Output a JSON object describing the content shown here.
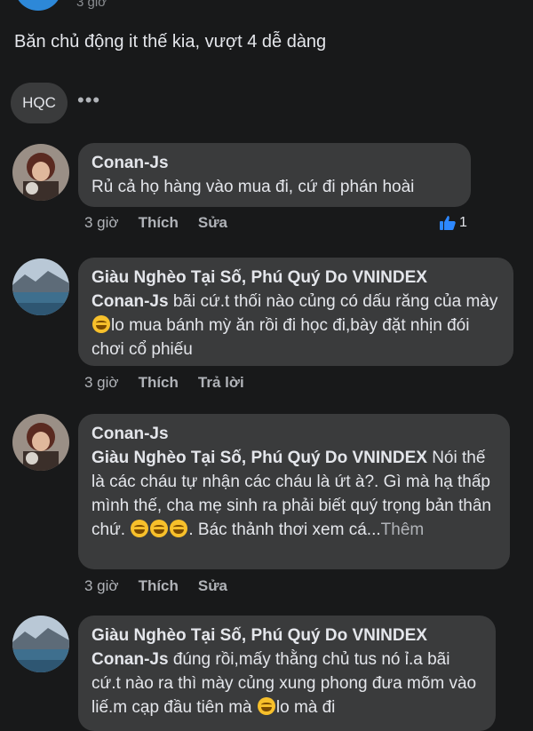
{
  "top": {
    "time": "3 giờ"
  },
  "post": {
    "text": "Băn chủ động it thế kia, vượt 4 dễ dàng"
  },
  "reply_bar": {
    "label": "HQC",
    "more": "•••"
  },
  "comments": [
    {
      "author": "Conan-Js",
      "text": "Rủ cả họ hàng vào mua đi, cứ đi phán hoài",
      "time": "3 giờ",
      "like": "Thích",
      "action2": "Sửa",
      "reactions": "1"
    },
    {
      "author": "Giàu Nghèo Tại Số, Phú Quý Do VNINDEX",
      "tag": "Conan-Js",
      "text_a": "  bãi cứ.t thối nào củng có dấu răng của mày ",
      "text_b": "lo mua bánh mỳ ăn rồi đi học đi,bày đặt nhịn đói chơi cổ phiếu",
      "time": "3 giờ",
      "like": "Thích",
      "action2": "Trả lời"
    },
    {
      "author": "Conan-Js",
      "tag": "Giàu Nghèo Tại Số, Phú Quý Do VNINDEX",
      "text_a": "  Nói thế là các cháu tự nhận các cháu là ứt à?. Gì mà hạ thấp mình thế, cha mẹ sinh ra phải biết quý trọng bản thân chứ. ",
      "text_b": ". Bác thảnh thơi xem cá...",
      "more": "Thêm",
      "time": "3 giờ",
      "like": "Thích",
      "action2": "Sửa"
    },
    {
      "author": "Giàu Nghèo Tại Số, Phú Quý Do VNINDEX",
      "tag": "Conan-Js",
      "text_a": "  đúng rồi,mấy thằng chủ tus nó ỉ.a bãi cứ.t nào ra thì mày củng xung phong đưa mõm vào liế.m cạp đầu tiên mà ",
      "text_b": "lo mà đi"
    }
  ],
  "colors": {
    "background": "#18191a",
    "bubble": "#3a3b3c",
    "like_blue": "#2d88ff"
  }
}
